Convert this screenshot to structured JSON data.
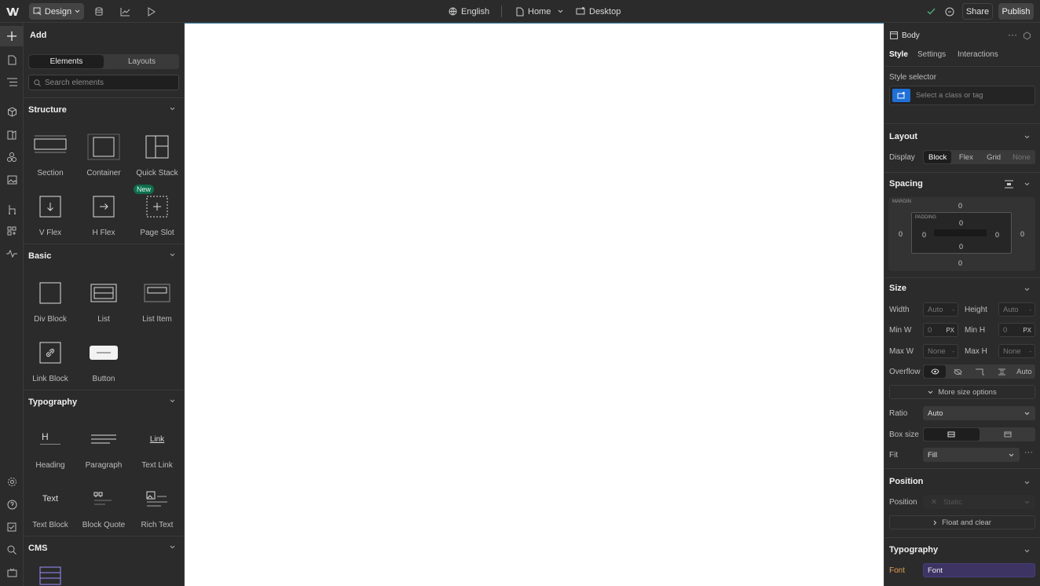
{
  "topbar": {
    "design_label": "Design",
    "language": "English",
    "page": "Home",
    "device": "Desktop",
    "share": "Share",
    "publish": "Publish"
  },
  "left": {
    "title": "Add",
    "tabs": [
      "Elements",
      "Layouts"
    ],
    "search_placeholder": "Search elements",
    "sections": {
      "structure": "Structure",
      "basic": "Basic",
      "typography": "Typography",
      "cms": "CMS"
    },
    "structure": [
      "Section",
      "Container",
      "Quick Stack",
      "V Flex",
      "H Flex",
      "Page Slot"
    ],
    "new_badge": "New",
    "basic": [
      "Div Block",
      "List",
      "List Item",
      "Link Block",
      "Button"
    ],
    "typography": [
      "Heading",
      "Paragraph",
      "Text Link",
      "Text Block",
      "Block Quote",
      "Rich Text"
    ],
    "typo_icon_heading": "H",
    "typo_icon_link": "Link",
    "typo_icon_text": "Text"
  },
  "right": {
    "element": "Body",
    "tabs": [
      "Style",
      "Settings",
      "Interactions"
    ],
    "style_selector": "Style selector",
    "selector_placeholder": "Select a class or tag",
    "layout": "Layout",
    "display": "Display",
    "display_opts": [
      "Block",
      "Flex",
      "Grid",
      "None"
    ],
    "spacing": "Spacing",
    "margin": "MARGIN",
    "padding": "PADDING",
    "size": "Size",
    "width": "Width",
    "height": "Height",
    "minw": "Min W",
    "minh": "Min H",
    "maxw": "Max W",
    "maxh": "Max H",
    "auto": "Auto",
    "zero": "0",
    "none": "None",
    "px": "PX",
    "overflow": "Overflow",
    "more_size": "More size options",
    "ratio": "Ratio",
    "box_size": "Box size",
    "fit": "Fit",
    "fill": "Fill",
    "position_h": "Position",
    "position": "Position",
    "static": "Static",
    "float": "Float and clear",
    "typography": "Typography",
    "font": "Font",
    "font_value": "Font"
  }
}
